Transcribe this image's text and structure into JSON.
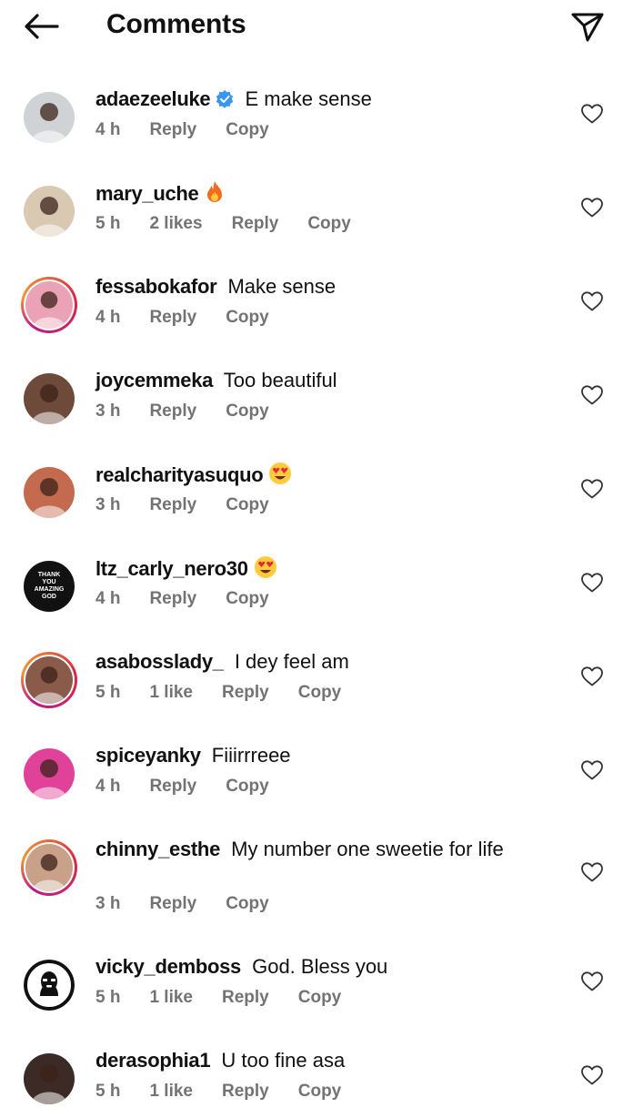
{
  "header": {
    "title": "Comments",
    "back_icon": "arrow-left-icon",
    "share_icon": "paper-plane-icon"
  },
  "colors": {
    "text": "#111111",
    "meta": "#737373",
    "verified": "#3897f0",
    "story_ring": "#dc2743"
  },
  "comments": [
    {
      "username": "adaezeeluke",
      "verified": true,
      "text": "E make sense",
      "emoji": "",
      "time": "4 h",
      "likes": "",
      "reply": "Reply",
      "copy": "Copy",
      "story": false,
      "avatar_bg": "#cfd3d6"
    },
    {
      "username": "mary_uche",
      "verified": false,
      "text": "",
      "emoji": "fire",
      "time": "5 h",
      "likes": "2 likes",
      "reply": "Reply",
      "copy": "Copy",
      "story": false,
      "avatar_bg": "#d9c9b3"
    },
    {
      "username": "fessabokafor",
      "verified": false,
      "text": "Make sense",
      "emoji": "",
      "time": "4 h",
      "likes": "",
      "reply": "Reply",
      "copy": "Copy",
      "story": true,
      "avatar_bg": "#e9a2b6"
    },
    {
      "username": "joycemmeka",
      "verified": false,
      "text": "Too beautiful",
      "emoji": "",
      "time": "3 h",
      "likes": "",
      "reply": "Reply",
      "copy": "Copy",
      "story": false,
      "avatar_bg": "#6e4a3a"
    },
    {
      "username": "realcharityasuquo",
      "verified": false,
      "text": "",
      "emoji": "heart-eyes",
      "time": "3 h",
      "likes": "",
      "reply": "Reply",
      "copy": "Copy",
      "story": false,
      "avatar_bg": "#c46a4e"
    },
    {
      "username": "ltz_carly_nero30",
      "verified": false,
      "text": "",
      "emoji": "heart-eyes",
      "time": "4 h",
      "likes": "",
      "reply": "Reply",
      "copy": "Copy",
      "story": false,
      "avatar_bg": "#111111",
      "avatar_text": "THANK YOU AMAZING GOD"
    },
    {
      "username": "asabosslady_",
      "verified": false,
      "text": "I dey feel am",
      "emoji": "",
      "time": "5 h",
      "likes": "1 like",
      "reply": "Reply",
      "copy": "Copy",
      "story": true,
      "avatar_bg": "#8a5a4a"
    },
    {
      "username": "spiceyanky",
      "verified": false,
      "text": "Fiiirrreee",
      "emoji": "",
      "time": "4 h",
      "likes": "",
      "reply": "Reply",
      "copy": "Copy",
      "story": false,
      "avatar_bg": "#e0429a"
    },
    {
      "username": "chinny_esthe",
      "verified": false,
      "text": "My number one sweetie for life",
      "emoji": "",
      "time": "3 h",
      "likes": "",
      "reply": "Reply",
      "copy": "Copy",
      "story": true,
      "avatar_bg": "#c9a088",
      "tall": true
    },
    {
      "username": "vicky_demboss",
      "verified": false,
      "text": "God. Bless you",
      "emoji": "",
      "time": "5 h",
      "likes": "1 like",
      "reply": "Reply",
      "copy": "Copy",
      "story": false,
      "avatar_bg": "#ffffff",
      "avatar_icon": "masked-person-icon"
    },
    {
      "username": "derasophia1",
      "verified": false,
      "text": "U too fine asa",
      "emoji": "",
      "time": "5 h",
      "likes": "1 like",
      "reply": "Reply",
      "copy": "Copy",
      "story": false,
      "avatar_bg": "#3b2a25"
    }
  ]
}
